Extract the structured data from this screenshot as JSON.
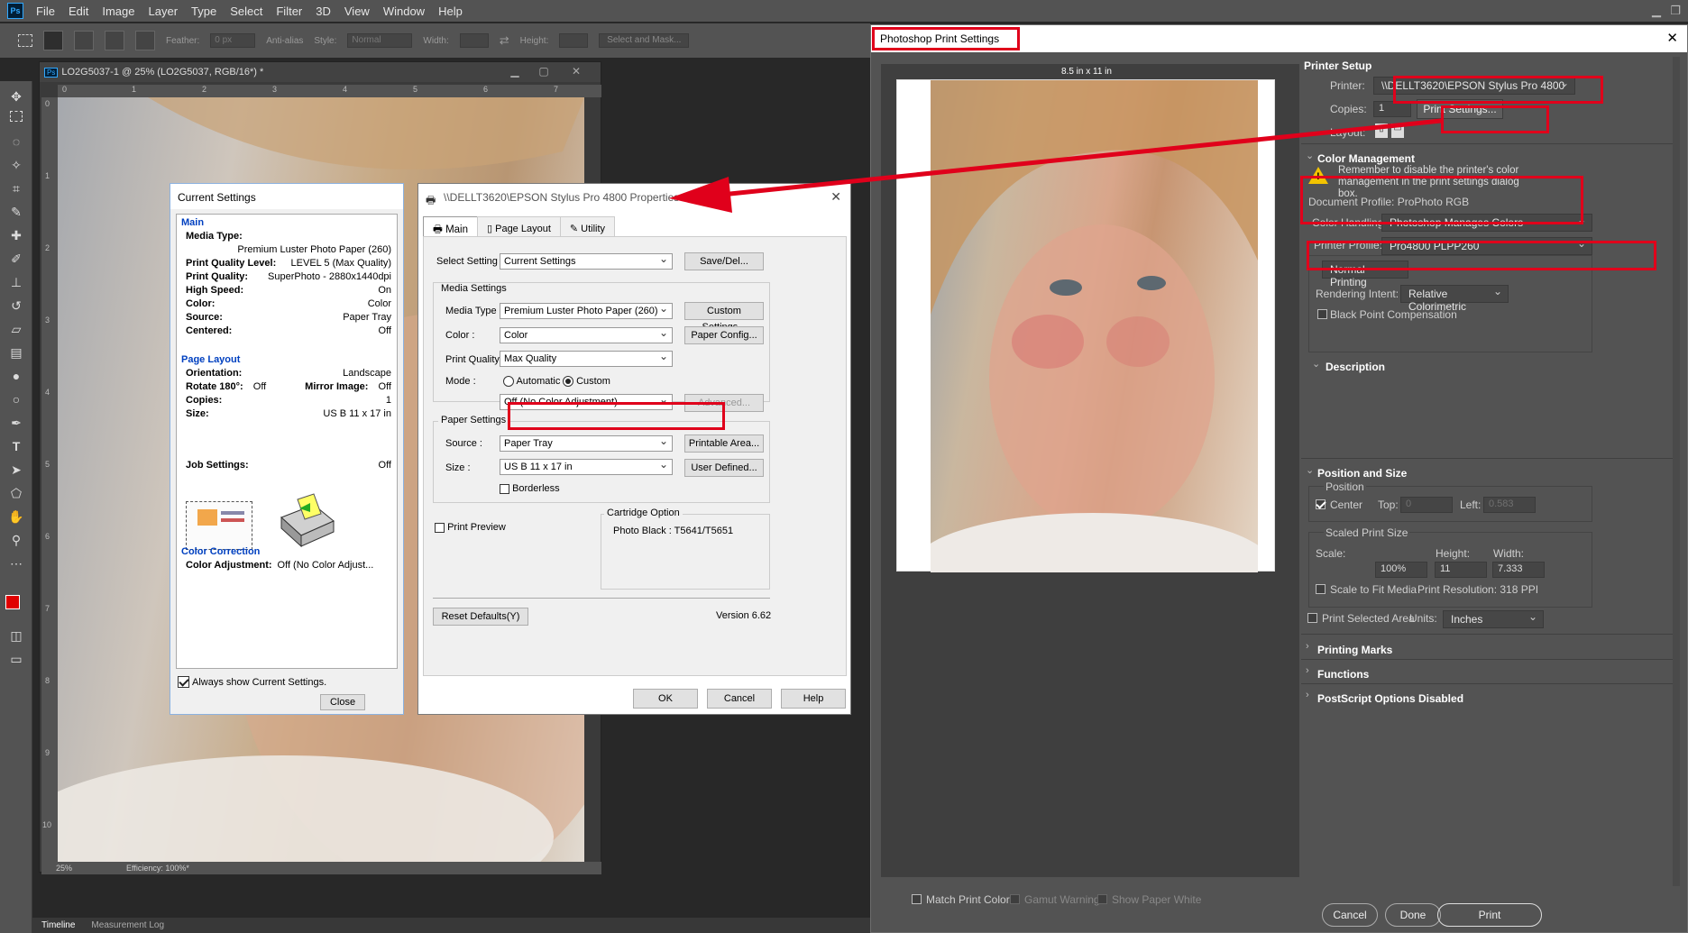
{
  "menubar": {
    "logo": "Ps",
    "items": [
      "File",
      "Edit",
      "Image",
      "Layer",
      "Type",
      "Select",
      "Filter",
      "3D",
      "View",
      "Window",
      "Help"
    ]
  },
  "options": {
    "feather_label": "Feather:",
    "feather_value": "0 px",
    "antialias": "Anti-alias",
    "style_label": "Style:",
    "style_value": "Normal",
    "width_label": "Width:",
    "height_label": "Height:",
    "select_mask": "Select and Mask..."
  },
  "document": {
    "tab": "LO2G5037-1 @ 25% (LO2G5037, RGB/16*) *",
    "zoom": "25%",
    "efficiency": "Efficiency: 100%*",
    "ruler_h": [
      "0",
      "1",
      "2",
      "3",
      "4",
      "5",
      "6",
      "7"
    ],
    "ruler_v": [
      "0",
      "1",
      "2",
      "3",
      "4",
      "5",
      "6",
      "7",
      "8",
      "9",
      "10"
    ]
  },
  "bottom_tabs": [
    "Timeline",
    "Measurement Log"
  ],
  "current_settings": {
    "title": "Current Settings",
    "main_header": "Main",
    "rows": [
      {
        "label": "Media Type:",
        "value": ""
      },
      {
        "label": "",
        "value": "Premium Luster Photo Paper (260)"
      },
      {
        "label": "Print Quality Level:",
        "value": "LEVEL 5 (Max Quality)"
      },
      {
        "label": "Print Quality:",
        "value": "SuperPhoto - 2880x1440dpi"
      },
      {
        "label": "High Speed:",
        "value": "On"
      },
      {
        "label": "Color:",
        "value": "Color"
      },
      {
        "label": "Source:",
        "value": "Paper Tray"
      },
      {
        "label": "Centered:",
        "value": "Off"
      }
    ],
    "layout_header": "Page Layout",
    "layout_rows": [
      {
        "label": "Orientation:",
        "value": "Landscape"
      },
      {
        "label": "Rotate 180°:",
        "value": "Off"
      },
      {
        "label": "Mirror Image:",
        "value": "Off"
      },
      {
        "label": "Copies:",
        "value": "1"
      },
      {
        "label": "Size:",
        "value": "US B 11 x 17 in"
      }
    ],
    "job_label": "Job Settings:",
    "job_value": "Off",
    "cc_header": "Color Correction",
    "cc_label": "Color Adjustment:",
    "cc_value": "Off (No Color Adjust...",
    "always_show": "Always show Current Settings.",
    "close": "Close"
  },
  "epson": {
    "title": "\\\\DELLT3620\\EPSON Stylus Pro 4800 Properties",
    "tabs": [
      "Main",
      "Page Layout",
      "Utility"
    ],
    "select_setting_label": "Select Setting :",
    "select_setting_value": "Current Settings",
    "save_del": "Save/Del...",
    "media_group": "Media Settings",
    "media_type_label": "Media Type :",
    "media_type_value": "Premium Luster Photo Paper (260)",
    "custom_settings": "Custom Settings...",
    "color_label": "Color :",
    "color_value": "Color",
    "paper_config": "Paper Config...",
    "pq_label": "Print Quality :",
    "pq_value": "Max Quality",
    "mode_label": "Mode :",
    "mode_auto": "Automatic",
    "mode_custom": "Custom",
    "mode_value": "Off (No Color Adjustment)",
    "advanced": "Advanced...",
    "paper_group": "Paper Settings",
    "source_label": "Source :",
    "source_value": "Paper Tray",
    "printable_area": "Printable Area...",
    "size_label": "Size :",
    "size_value": "US B 11 x 17 in",
    "user_defined": "User Defined...",
    "borderless": "Borderless",
    "print_preview": "Print Preview",
    "cartridge_group": "Cartridge Option",
    "cartridge_value": "Photo Black : T5641/T5651",
    "reset": "Reset Defaults(Y)",
    "version": "Version 6.62",
    "ok": "OK",
    "cancel": "Cancel",
    "help": "Help"
  },
  "print_settings": {
    "title": "Photoshop Print Settings",
    "paper_size": "8.5 in x 11 in",
    "printer_setup": "Printer Setup",
    "printer_label": "Printer:",
    "printer_value": "\\\\DELLT3620\\EPSON Stylus Pro 4800",
    "copies_label": "Copies:",
    "copies_value": "1",
    "print_settings_btn": "Print Settings...",
    "layout_label": "Layout:",
    "cm_header": "Color Management",
    "cm_warning": "Remember to disable the printer's color management in the print settings dialog box.",
    "doc_profile": "Document Profile: ProPhoto RGB",
    "ch_label": "Color Handling:",
    "ch_value": "Photoshop Manages Colors",
    "pp_label": "Printer Profile:",
    "pp_value": "Pro4800 PLPP260",
    "normal_printing": "Normal Printing",
    "ri_label": "Rendering Intent:",
    "ri_value": "Relative Colorimetric",
    "bpc": "Black Point Compensation",
    "description": "Description",
    "pos_header": "Position and Size",
    "position": "Position",
    "center": "Center",
    "top_label": "Top:",
    "top_value": "0",
    "left_label": "Left:",
    "left_value": "0.583",
    "sps": "Scaled Print Size",
    "scale_label": "Scale:",
    "scale_value": "100%",
    "height_label": "Height:",
    "height_value": "11",
    "width_label": "Width:",
    "width_value": "7.333",
    "scale_fit": "Scale to Fit Media",
    "print_res": "Print Resolution: 318 PPI",
    "psa": "Print Selected Area",
    "units_label": "Units:",
    "units_value": "Inches",
    "printing_marks": "Printing Marks",
    "functions": "Functions",
    "postscript": "PostScript Options Disabled",
    "match_colors": "Match Print Colors",
    "gamut": "Gamut Warning",
    "show_white": "Show Paper White",
    "cancel": "Cancel",
    "done": "Done",
    "print": "Print"
  },
  "colors": {
    "highlight": "#e0001b",
    "ps_bg": "#535353"
  }
}
